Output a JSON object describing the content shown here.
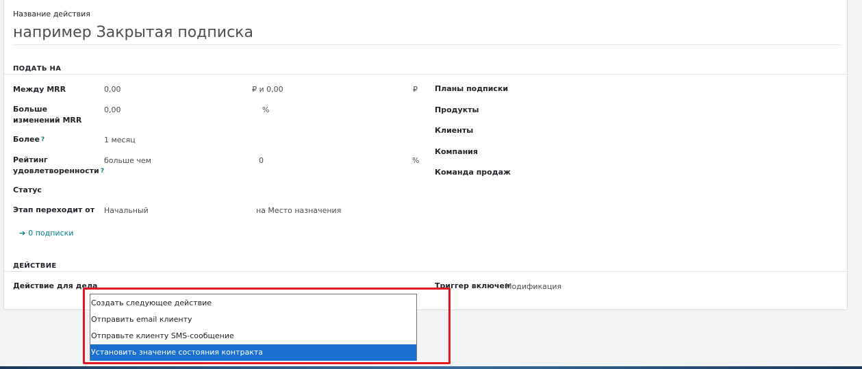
{
  "form": {
    "name_label": "Название действия",
    "name_placeholder": "например Закрытая подписка"
  },
  "apply_section": {
    "title": "ПОДАТЬ НА",
    "mrr_between": {
      "label": "Между MRR",
      "value_from": "0,00",
      "currency_and": "₽ и 0,00",
      "currency": "₽"
    },
    "mrr_change": {
      "label": "Больше изменений MRR",
      "value": "0,00",
      "unit": "%"
    },
    "over": {
      "label": "Более",
      "help": "?",
      "value": "1 месяц"
    },
    "satisfaction": {
      "label": "Рейтинг удовлетворенности",
      "help": "?",
      "operator": "больше чем",
      "value": "0",
      "unit": "%"
    },
    "status": {
      "label": "Статус"
    },
    "stage_from": {
      "label": "Этап переходит от",
      "from_value": "Начальный",
      "to_value": "на Место назначения"
    },
    "subscriptions_link": "0 подписки",
    "right_fields": [
      "Планы подписки",
      "Продукты",
      "Клиенты",
      "Компания",
      "Команда продаж"
    ]
  },
  "action_section": {
    "title": "ДЕЙСТВИЕ",
    "action_label": "Действие для дела",
    "trigger_label": "Триггер включен",
    "trigger_value": "Модификация"
  },
  "dropdown": {
    "options": [
      "Создать следующее действие",
      "Отправить email клиенту",
      "Отправьте клиенту SMS-сообщение",
      "Установить значение состояния контракта"
    ],
    "selected_index": 3
  },
  "colors": {
    "accent": "#017e84",
    "selected_option": "#1a6fd1",
    "highlight_box": "#e2161c"
  }
}
